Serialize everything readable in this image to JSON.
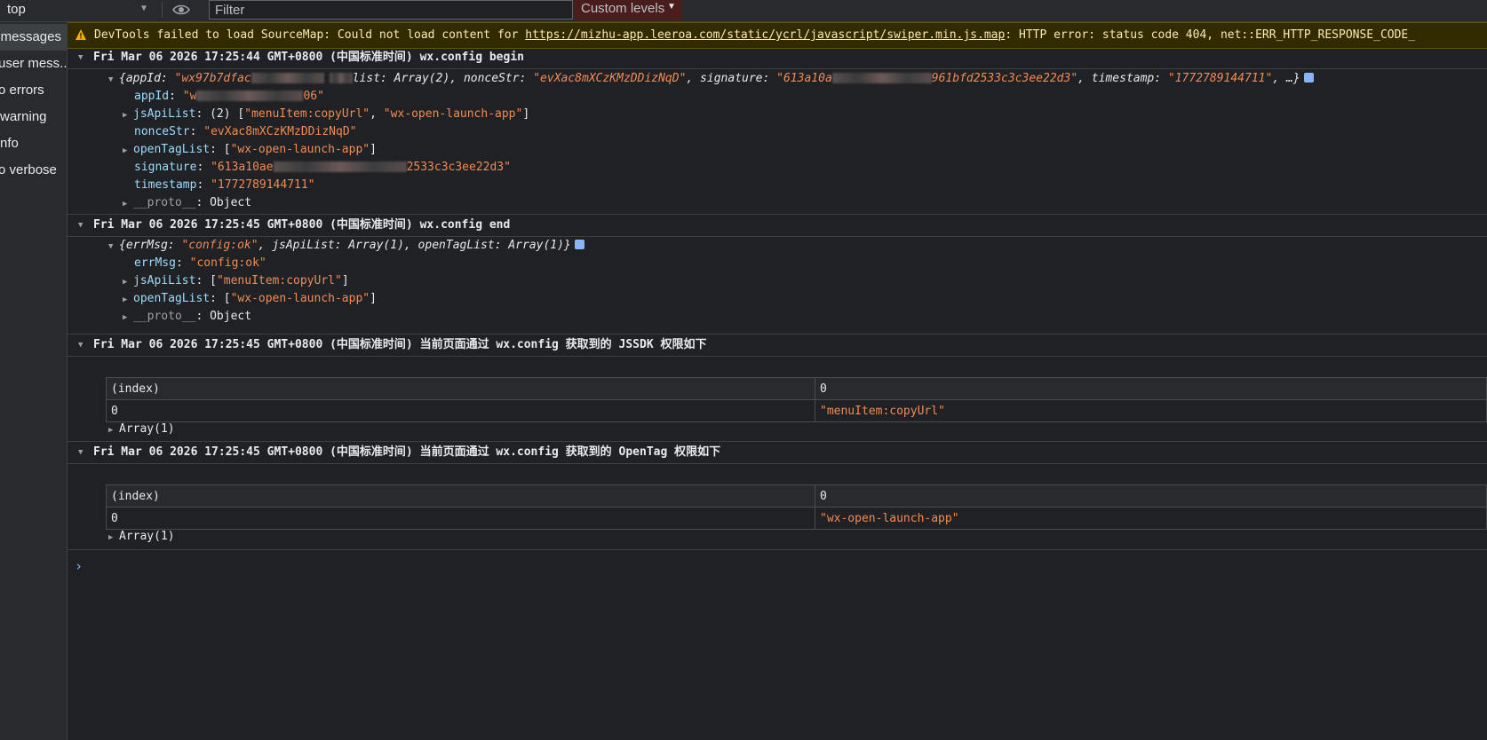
{
  "toolbar": {
    "context": "top",
    "filter_placeholder": "Filter",
    "levels": "Custom levels"
  },
  "sidebar": {
    "items": [
      {
        "label": "messages"
      },
      {
        "label": "user mess..."
      },
      {
        "label": "o errors"
      },
      {
        "label": "warning"
      },
      {
        "label": "nfo"
      },
      {
        "label": "o verbose"
      }
    ]
  },
  "warning": {
    "prefix": "DevTools failed to load SourceMap: Could not load content for ",
    "url": "https://mizhu-app.leeroa.com/static/ycrl/javascript/swiper.min.js.map",
    "suffix": ": HTTP error: status code 404, net::ERR_HTTP_RESPONSE_CODE_"
  },
  "groups": [
    {
      "title": "Fri Mar 06 2026 17:25:44 GMT+0800 (中国标准时间) wx.config begin"
    },
    {
      "title": "Fri Mar 06 2026 17:25:45 GMT+0800 (中国标准时间) wx.config end"
    },
    {
      "title": "Fri Mar 06 2026 17:25:45 GMT+0800 (中国标准时间) 当前页面通过 wx.config 获取到的 JSSDK 权限如下"
    },
    {
      "title": "Fri Mar 06 2026 17:25:45 GMT+0800 (中国标准时间) 当前页面通过 wx.config 获取到的 OpenTag 权限如下"
    }
  ],
  "config_begin": {
    "summary_prefix": "{appId: ",
    "summary_appid": "\"wx97b7dfac",
    "summary_mid": "list: Array(2), nonceStr: ",
    "summary_nonce": "\"evXac8mXCzKMzDDizNqD\"",
    "summary_sig_key": ", signature: ",
    "summary_sig": "\"613a10a",
    "summary_sig_end": "961bfd2533c3c3ee22d3\"",
    "summary_ts_key": ", timestamp: ",
    "summary_ts": "\"1772789144711\"",
    "summary_end": ", …}",
    "appId_key": "appId",
    "appId_start": "\"w",
    "appId_end": "06\"",
    "jsApiList_key": "jsApiList",
    "jsApiList_count": "(2) [",
    "jsApiList_v1": "\"menuItem:copyUrl\"",
    "jsApiList_v2": "\"wx-open-launch-app\"",
    "nonceStr_key": "nonceStr",
    "nonceStr_val": "\"evXac8mXCzKMzDDizNqD\"",
    "openTagList_key": "openTagList",
    "openTagList_val": "\"wx-open-launch-app\"",
    "signature_key": "signature",
    "signature_start": "\"613a10ae",
    "signature_end": "2533c3c3ee22d3\"",
    "timestamp_key": "timestamp",
    "timestamp_val": "\"1772789144711\"",
    "proto_key": "__proto__",
    "proto_val": "Object"
  },
  "config_end": {
    "summary_a": "{errMsg: ",
    "summary_errmsg": "\"config:ok\"",
    "summary_b": ", jsApiList: Array(1), openTagList: Array(1)}",
    "errMsg_key": "errMsg",
    "errMsg_val": "\"config:ok\"",
    "jsApiList_key": "jsApiList",
    "jsApiList_val": "\"menuItem:copyUrl\"",
    "openTagList_key": "openTagList",
    "openTagList_val": "\"wx-open-launch-app\"",
    "proto_key": "__proto__",
    "proto_val": "Object"
  },
  "table_jssdk": {
    "headers": [
      "(index)",
      "0"
    ],
    "row": [
      "0",
      "\"menuItem:copyUrl\""
    ],
    "footer": "Array(1)"
  },
  "table_opentag": {
    "headers": [
      "(index)",
      "0"
    ],
    "row": [
      "0",
      "\"wx-open-launch-app\""
    ],
    "footer": "Array(1)"
  },
  "prompt": "›"
}
